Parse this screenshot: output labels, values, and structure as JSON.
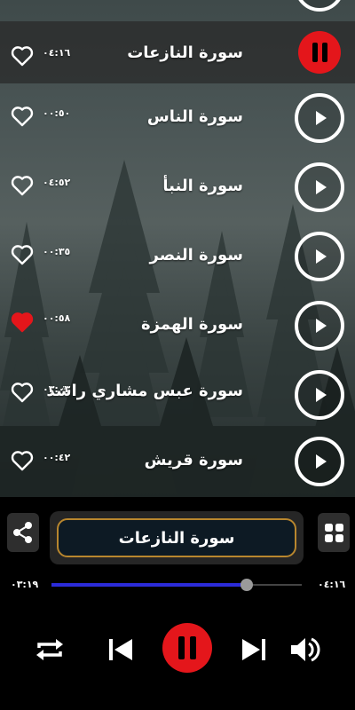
{
  "tracks": [
    {
      "title": "سورة النازعات",
      "duration": "٠٤:١٦",
      "favorite": false,
      "playing": true
    },
    {
      "title": "سورة الناس",
      "duration": "٠٠:٥٠",
      "favorite": false,
      "playing": false
    },
    {
      "title": "سورة النبأ",
      "duration": "٠٤:٥٢",
      "favorite": false,
      "playing": false
    },
    {
      "title": "سورة النصر",
      "duration": "٠٠:٣٥",
      "favorite": false,
      "playing": false
    },
    {
      "title": "سورة الهمزة",
      "duration": "٠٠:٥٨",
      "favorite": true,
      "playing": false
    },
    {
      "title": "سورة عبس مشاري راشد",
      "duration": "٠٣:٠٣",
      "favorite": false,
      "playing": false
    },
    {
      "title": "سورة قريش",
      "duration": "٠٠:٤٢",
      "favorite": false,
      "playing": false
    }
  ],
  "player": {
    "now_playing": "سورة النازعات",
    "elapsed": "٠٣:١٩",
    "total": "٠٤:١٦",
    "progress": 0.78
  },
  "icons": {
    "share": "share-icon",
    "grid": "grid-icon",
    "repeat": "repeat-icon",
    "previous": "skip-previous-icon",
    "pause": "pause-icon",
    "next": "skip-next-icon",
    "volume": "volume-icon"
  },
  "colors": {
    "accent_red": "#e4161b",
    "seek_blue": "#2b2bd9",
    "frame_gold": "#b8862e",
    "heart_active": "#e4161b"
  }
}
